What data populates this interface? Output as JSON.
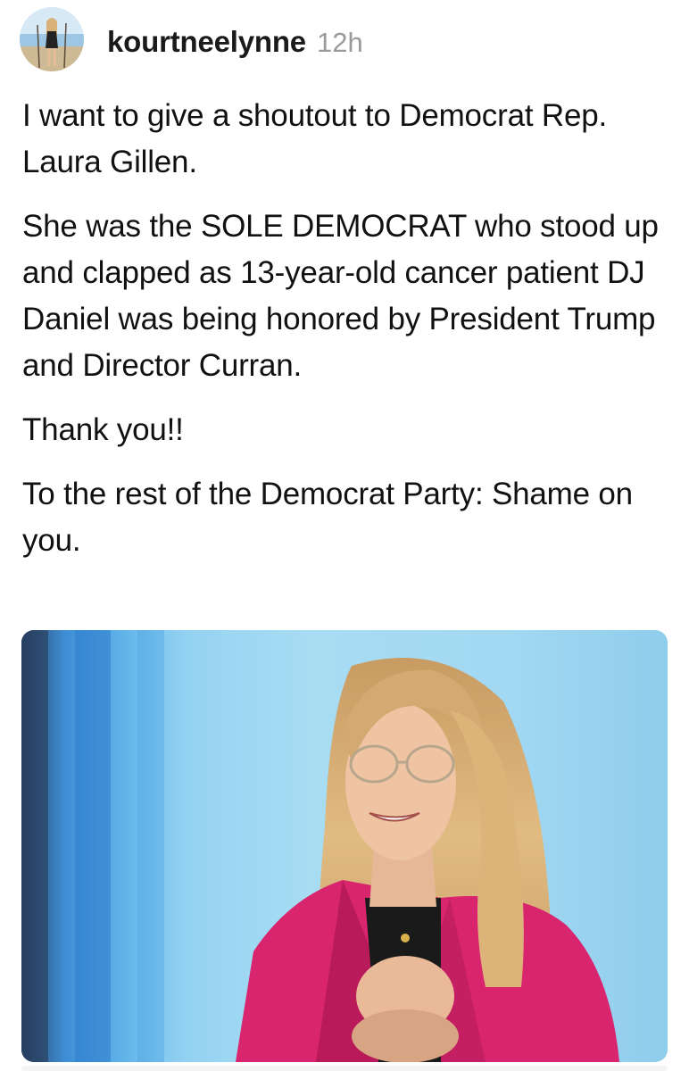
{
  "post": {
    "username": "kourtneelynne",
    "timestamp": "12h",
    "avatar_icon": "profile-photo",
    "paragraphs": [
      "I want to give a shoutout to Democrat Rep. Laura Gillen.",
      "She was the SOLE DEMOCRAT who stood up and clapped as 13-year-old cancer patient DJ Daniel was being honored by President Trump and Director Curran.",
      "Thank you!!",
      "To the rest of the Democrat Party: Shame on you."
    ],
    "image": {
      "subject": "photo-of-woman-in-pink-blazer",
      "colors": {
        "background": "#a8dcf3",
        "blazer": "#d8256e",
        "hair": "#d9b27a"
      }
    }
  }
}
